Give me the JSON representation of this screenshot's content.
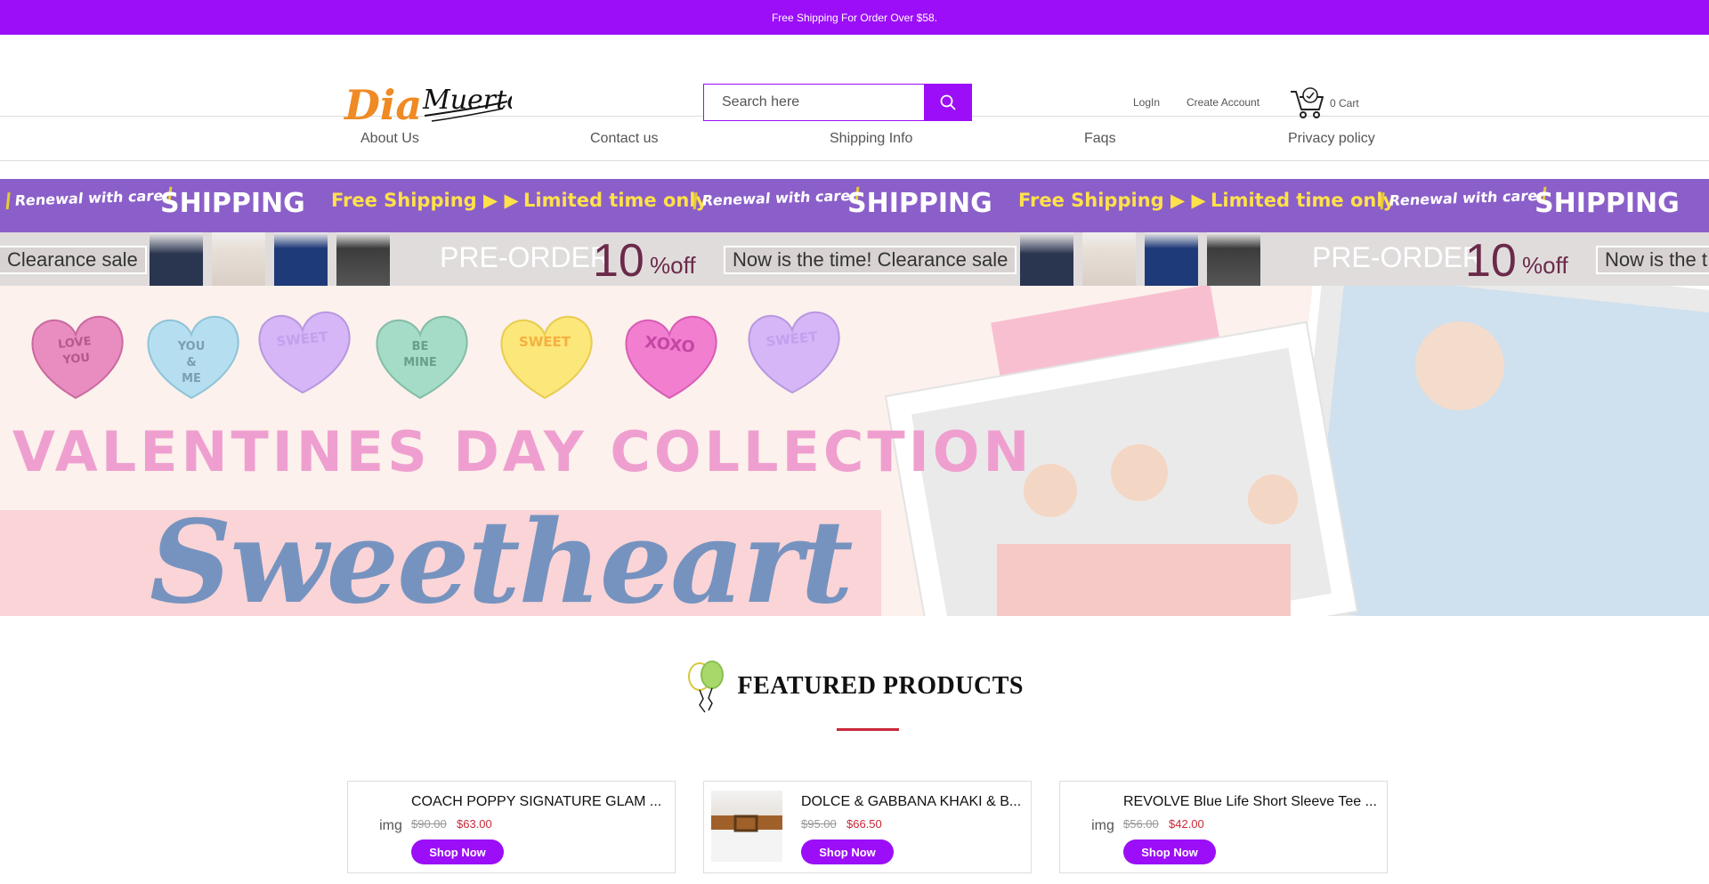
{
  "topbar": {
    "text": "Free Shipping For Order Over $58."
  },
  "header": {
    "logo_alt": "Dia Muertos",
    "search_placeholder": "Search here",
    "login": "LogIn",
    "create_account": "Create Account",
    "cart": "0 Cart"
  },
  "nav": {
    "items": [
      "About Us",
      "Contact us",
      "Shipping Info",
      "Faqs",
      "Privacy policy"
    ]
  },
  "banner_top": {
    "renewal": "Renewal with care",
    "shipping": "SHIPPING",
    "free_shipping": "Free Shipping ▶ ▶",
    "limited": "Limited time only"
  },
  "banner_second": {
    "clearance": "Clearance sale",
    "preorder": "PRE-ORDER",
    "percent": "10",
    "off": "%off",
    "now": "Now is the time! Clearance sale",
    "now_cut": "Now is the t"
  },
  "hero": {
    "hearts": [
      "LOVE YOU",
      "YOU & ME",
      "SWEET",
      "BE MINE",
      "SWEET",
      "XOXO",
      "SWEET"
    ],
    "collection": "VALENTINES DAY COLLECTION",
    "headline": "Sweetheart"
  },
  "featured": {
    "title": "FEATURED PRODUCTS",
    "products": [
      {
        "title": "COACH POPPY SIGNATURE GLAM TOTE",
        "title_display": "COACH POPPY SIGNATURE GLAM ...",
        "old_price": "$90.00",
        "price": "$63.00",
        "button": "Shop Now",
        "img_alt": "img"
      },
      {
        "title": "DOLCE & GABBANA KHAKI & BROWN BELT",
        "title_display": "DOLCE & GABBANA KHAKI & B...",
        "old_price": "$95.00",
        "price": "$66.50",
        "button": "Shop Now",
        "img_alt": ""
      },
      {
        "title": "REVOLVE Blue Life Short Sleeve Tee",
        "title_display": "REVOLVE Blue Life Short Sleeve Tee ...",
        "old_price": "$56.00",
        "price": "$42.00",
        "button": "Shop Now",
        "img_alt": "img"
      }
    ]
  },
  "colors": {
    "accent": "#9b0ef7",
    "sale": "#c8283a",
    "ticker": "#8b5fc9"
  }
}
